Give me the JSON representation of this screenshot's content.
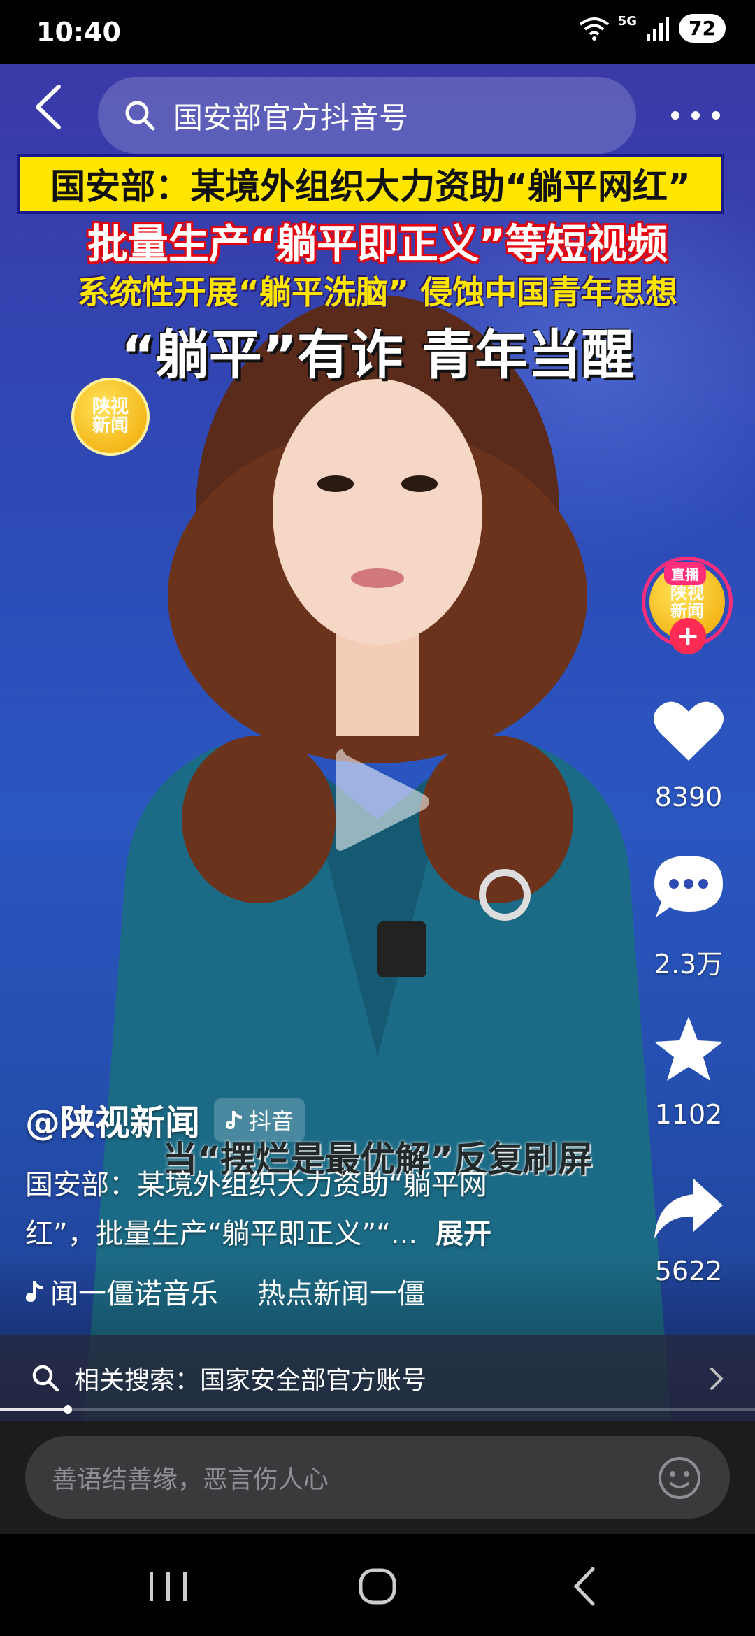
{
  "status_bar": {
    "time": "10:40",
    "network": "5G",
    "battery": "72"
  },
  "top_bar": {
    "search_text": "国安部官方抖音号"
  },
  "video": {
    "banner1": "国安部：某境外组织大力资助“躺平网红”",
    "banner2": "批量生产“躺平即正义”等短视频",
    "banner3": "系统性开展“躺平洗脑” 侵蚀中国青年思想",
    "banner4": "“躺平”有诈 青年当醒",
    "channel_logo": "陕视\n新闻",
    "subtitle": "当“摆烂是最优解”反复刷屏",
    "progress": 0.09
  },
  "rail": {
    "live_tag": "直播",
    "avatar_text": "陕视\n新闻",
    "follow": "+",
    "likes": "8390",
    "comments": "2.3万",
    "favorites": "1102",
    "shares": "5622"
  },
  "info": {
    "author": "@陕视新闻",
    "platform_tag": "抖音",
    "description_line1": "国安部：某境外组织大力资助“躺平网",
    "description_line2": "红”，批量生产“躺平即正义”“...",
    "expand": "展开",
    "music_part1": "闻一僵诺音乐",
    "music_part2": "热点新闻一僵"
  },
  "related_search": {
    "label": "相关搜索：国家安全部官方账号"
  },
  "comment_bar": {
    "placeholder": "善语结善缘，恶言伤人心"
  },
  "colors": {
    "accent": "#fe2c55",
    "banner_yellow": "#ffe600",
    "background": "#2a56c0"
  }
}
